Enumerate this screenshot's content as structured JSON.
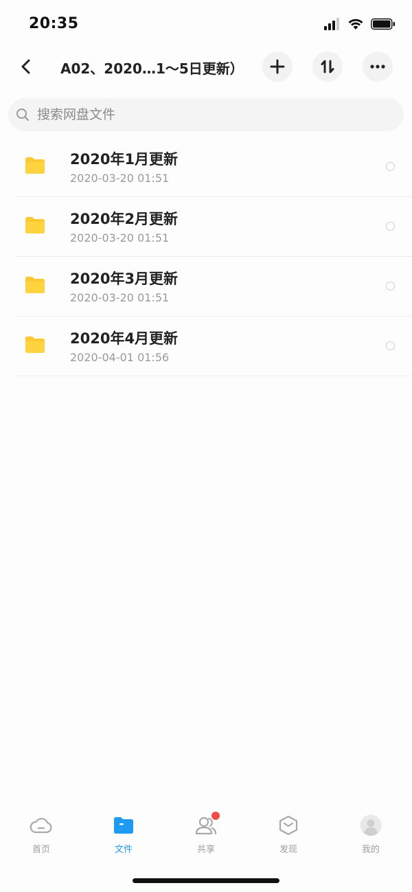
{
  "status_bar": {
    "time": "20:35"
  },
  "nav": {
    "title": "A02、2020…1～5日更新）"
  },
  "search": {
    "placeholder": "搜索网盘文件",
    "value": ""
  },
  "files": [
    {
      "name": "2020年1月更新",
      "date": "2020-03-20 01:51"
    },
    {
      "name": "2020年2月更新",
      "date": "2020-03-20 01:51"
    },
    {
      "name": "2020年3月更新",
      "date": "2020-03-20 01:51"
    },
    {
      "name": "2020年4月更新",
      "date": "2020-04-01 01:56"
    }
  ],
  "tabs": [
    {
      "label": "首页",
      "icon": "cloud-icon",
      "active": false
    },
    {
      "label": "文件",
      "icon": "folder-icon",
      "active": true
    },
    {
      "label": "共享",
      "icon": "people-icon",
      "active": false,
      "badge": true
    },
    {
      "label": "发现",
      "icon": "hexagon-icon",
      "active": false
    },
    {
      "label": "我的",
      "icon": "avatar-icon",
      "active": false
    }
  ],
  "colors": {
    "accent": "#1e9bf0",
    "folder": "#fcc933",
    "badge": "#f04a49"
  }
}
